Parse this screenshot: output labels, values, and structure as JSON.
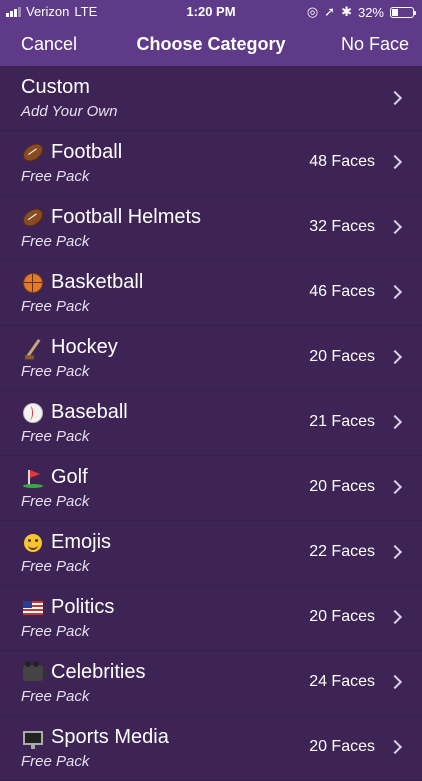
{
  "status": {
    "carrier": "Verizon",
    "network": "LTE",
    "time": "1:20 PM",
    "battery": "32%",
    "battery_level": 0.32
  },
  "nav": {
    "left": "Cancel",
    "title": "Choose Category",
    "right": "No Face"
  },
  "rows": [
    {
      "title": "Custom",
      "subtitle": "Add Your Own",
      "count": "",
      "icon": "none"
    },
    {
      "title": "Football",
      "subtitle": "Free Pack",
      "count": "48 Faces",
      "icon": "football-icon"
    },
    {
      "title": "Football Helmets",
      "subtitle": "Free Pack",
      "count": "32 Faces",
      "icon": "football-icon"
    },
    {
      "title": "Basketball",
      "subtitle": "Free Pack",
      "count": "46 Faces",
      "icon": "basketball-icon"
    },
    {
      "title": "Hockey",
      "subtitle": "Free Pack",
      "count": "20 Faces",
      "icon": "hockey-stick-icon"
    },
    {
      "title": "Baseball",
      "subtitle": "Free Pack",
      "count": "21 Faces",
      "icon": "baseball-icon"
    },
    {
      "title": "Golf",
      "subtitle": "Free Pack",
      "count": "20 Faces",
      "icon": "golf-flag-icon"
    },
    {
      "title": "Emojis",
      "subtitle": "Free Pack",
      "count": "22 Faces",
      "icon": "emoji-icon"
    },
    {
      "title": "Politics",
      "subtitle": "Free Pack",
      "count": "20 Faces",
      "icon": "us-flag-icon"
    },
    {
      "title": "Celebrities",
      "subtitle": "Free Pack",
      "count": "24 Faces",
      "icon": "movie-camera-icon"
    },
    {
      "title": "Sports Media",
      "subtitle": "Free Pack",
      "count": "20 Faces",
      "icon": "monitor-icon"
    }
  ],
  "colors": {
    "nav_bg": "#5e3a89",
    "list_bg": "#3d2455"
  }
}
